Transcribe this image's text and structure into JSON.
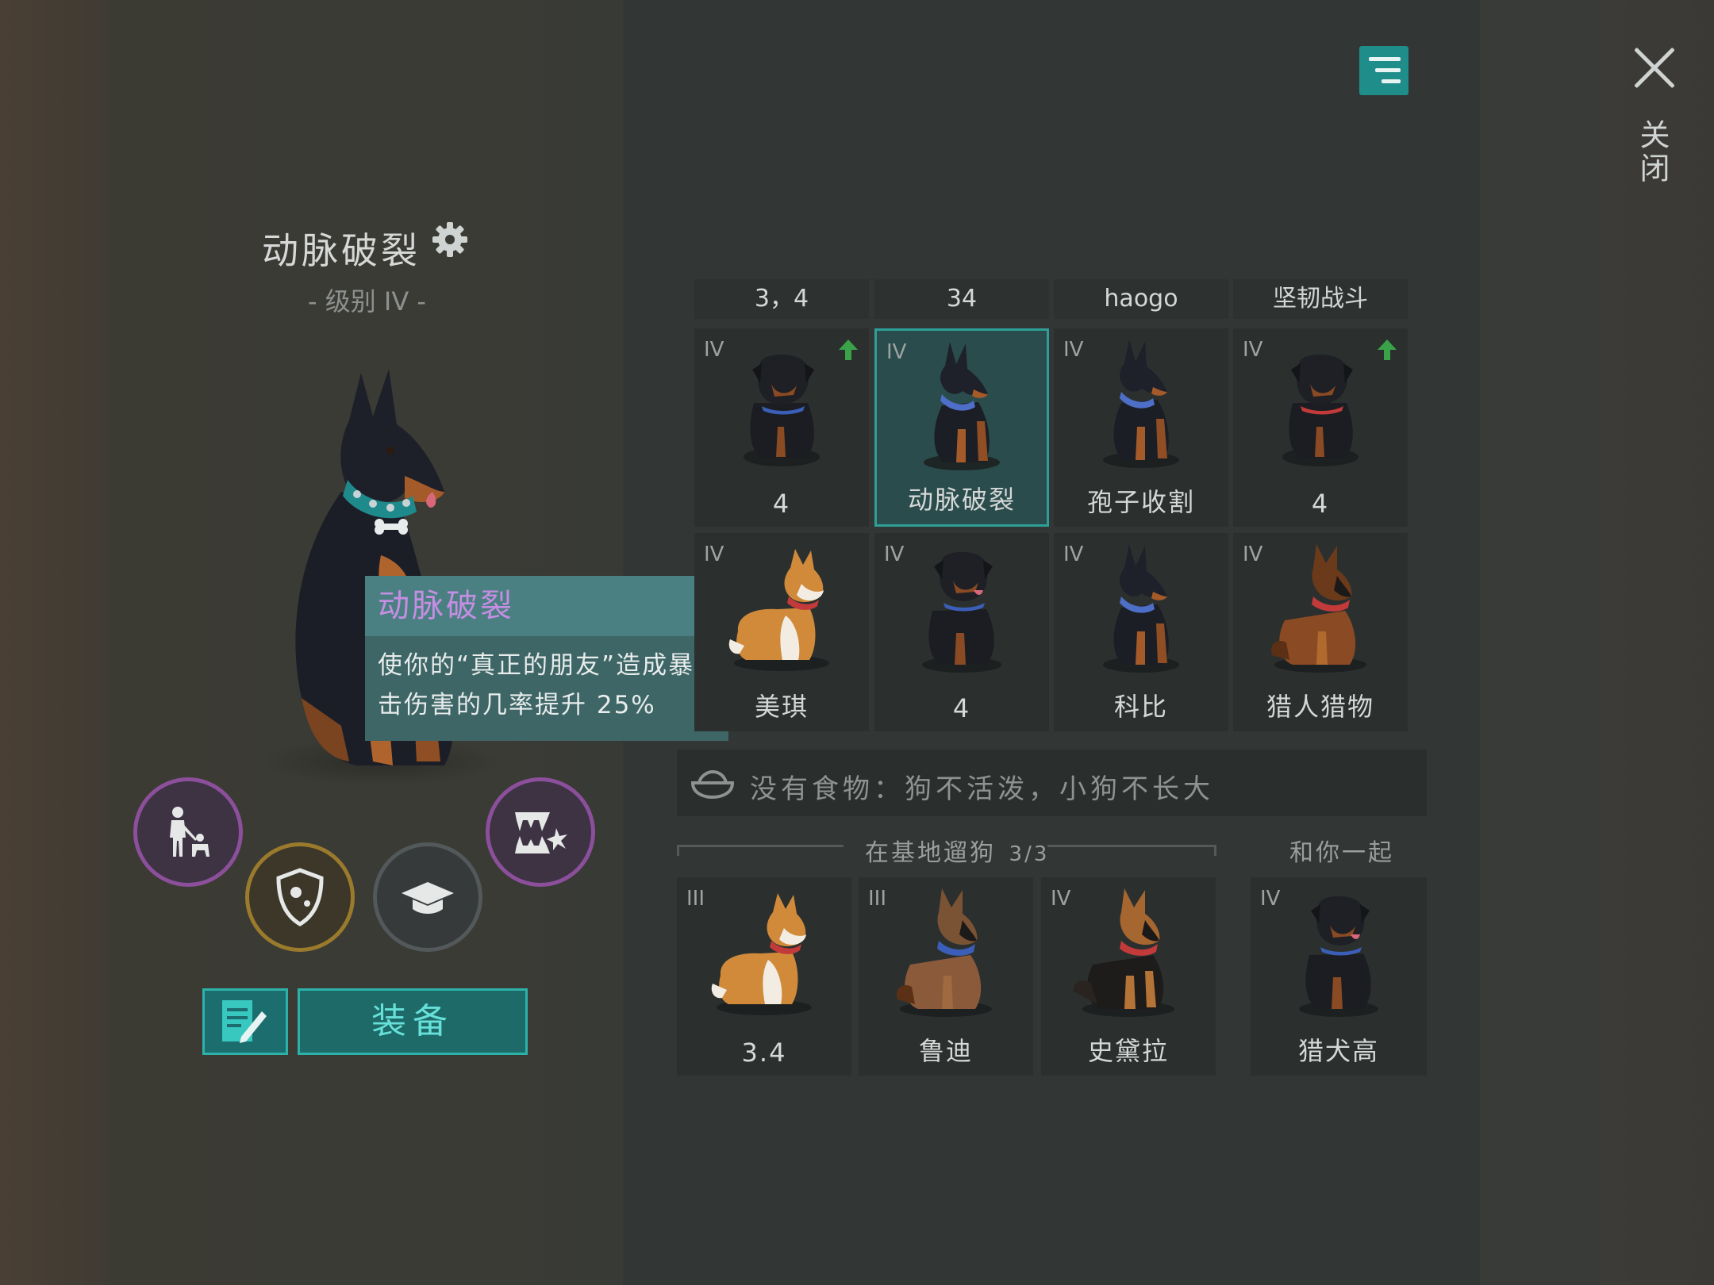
{
  "close": {
    "label": "关闭"
  },
  "dog": {
    "name": "动脉破裂",
    "level": "- 级别 IV -"
  },
  "tooltip": {
    "title": "动脉破裂",
    "line1": "使你的“真正的朋友”造成暴",
    "line2": "击伤害的几率提升 25%"
  },
  "buttons": {
    "equip": "装备"
  },
  "tabs": [
    "3，4",
    "34",
    "haogo",
    "坚韧战斗"
  ],
  "grid_row1": [
    {
      "level": "IV",
      "name": "4",
      "upgrade": true,
      "breed": "rottweiler"
    },
    {
      "level": "IV",
      "name": "动脉破裂",
      "upgrade": false,
      "breed": "doberman",
      "selected": true
    },
    {
      "level": "IV",
      "name": "孢子收割",
      "upgrade": false,
      "breed": "doberman"
    },
    {
      "level": "IV",
      "name": "4",
      "upgrade": true,
      "breed": "rottweiler"
    }
  ],
  "grid_row2": [
    {
      "level": "IV",
      "name": "美琪",
      "breed": "corgi"
    },
    {
      "level": "IV",
      "name": "4",
      "breed": "rottweiler"
    },
    {
      "level": "IV",
      "name": "科比",
      "breed": "doberman"
    },
    {
      "level": "IV",
      "name": "猎人猎物",
      "breed": "shepherd"
    }
  ],
  "food_notice": "没有食物：狗不活泼，小狗不长大",
  "walking": {
    "label": "在基地遛狗",
    "count": "3/3"
  },
  "with_you": {
    "label": "和你一起"
  },
  "bottom_row": [
    {
      "level": "III",
      "name": "3.4",
      "breed": "corgi"
    },
    {
      "level": "III",
      "name": "鲁迪",
      "breed": "shepherd"
    },
    {
      "level": "IV",
      "name": "史黛拉",
      "breed": "shepherd"
    }
  ],
  "companion": {
    "level": "IV",
    "name": "猎犬高",
    "breed": "rottweiler"
  },
  "colors": {
    "accent": "#2db2aa",
    "purple": "#8c4f9b",
    "gold": "#9a7a2c",
    "tooltip_title": "#c58ee2"
  }
}
